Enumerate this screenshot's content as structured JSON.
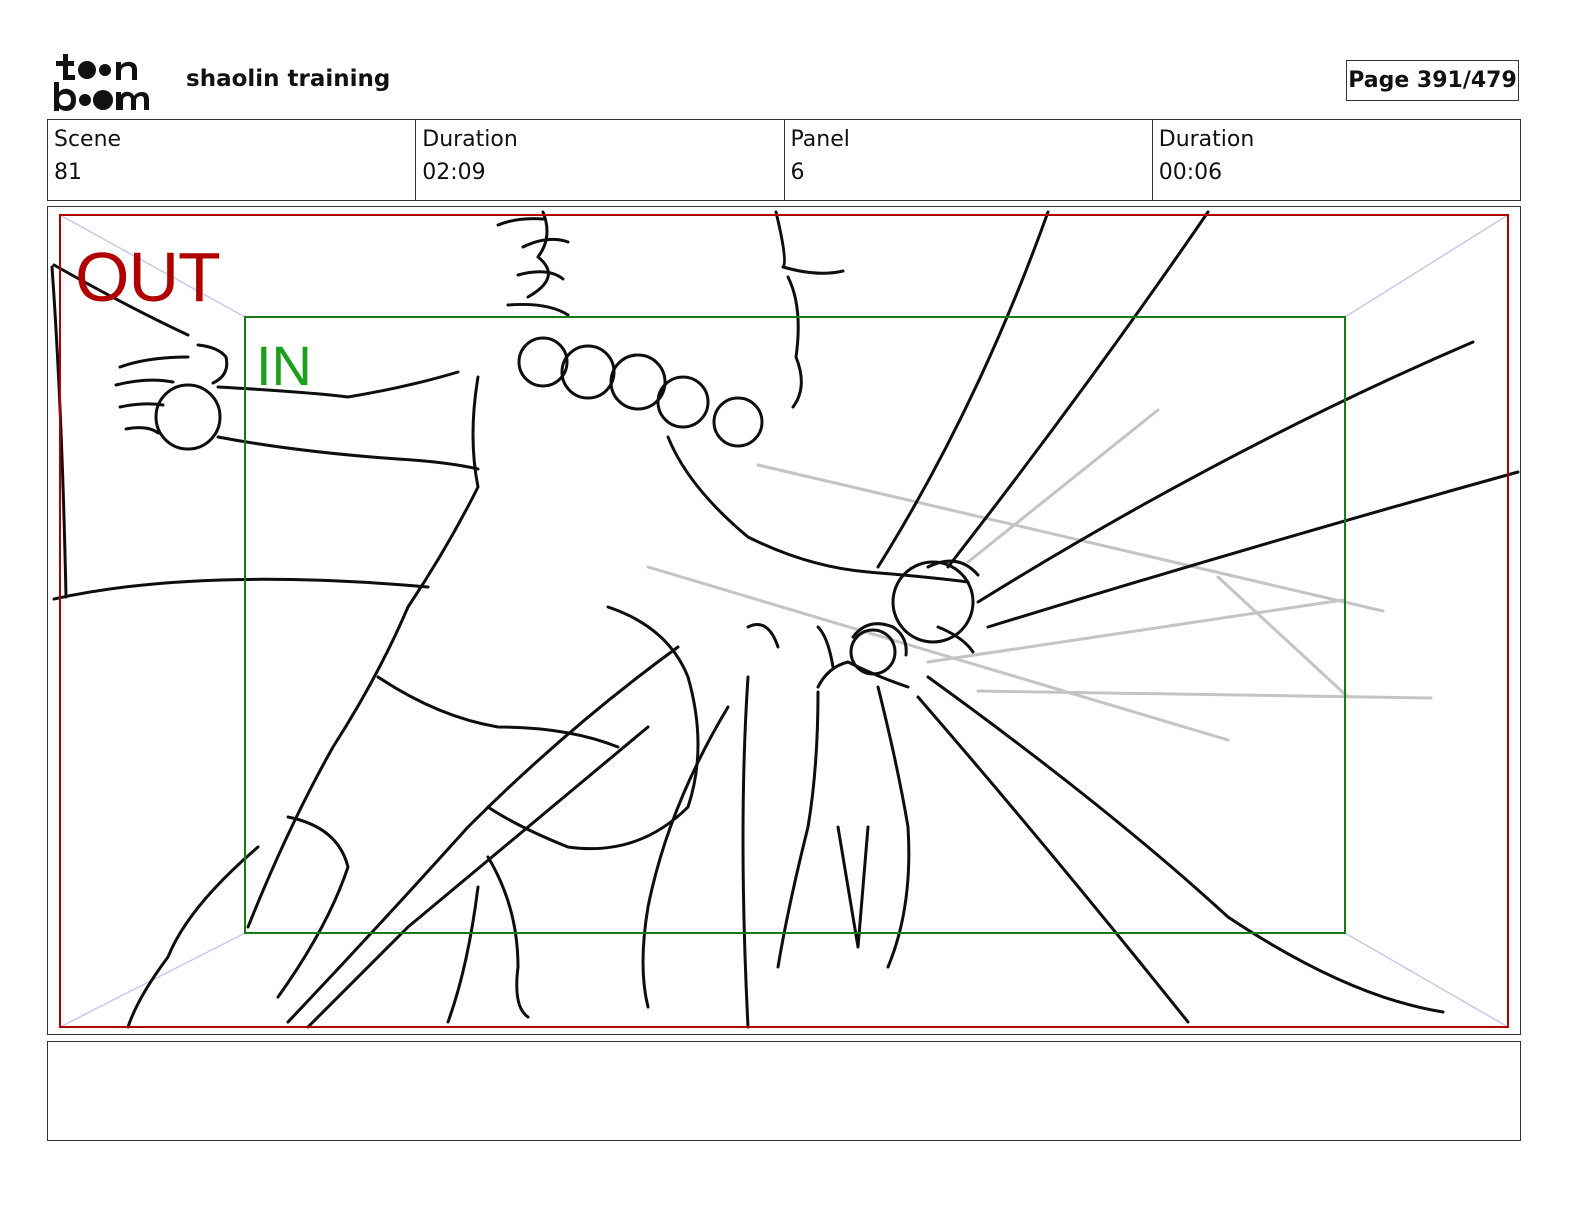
{
  "header": {
    "logo_text": "toon boom",
    "project_title": "shaolin training",
    "page_label": "Page 391/479"
  },
  "info": {
    "scene_label": "Scene",
    "scene_value": "81",
    "scene_duration_label": "Duration",
    "scene_duration_value": "02:09",
    "panel_label": "Panel",
    "panel_value": "6",
    "panel_duration_label": "Duration",
    "panel_duration_value": "00:06"
  },
  "panel": {
    "out_label": "OUT",
    "in_label": "IN",
    "out_color": "#b00000",
    "in_color": "#1ca01c"
  },
  "notes": {
    "text": ""
  }
}
